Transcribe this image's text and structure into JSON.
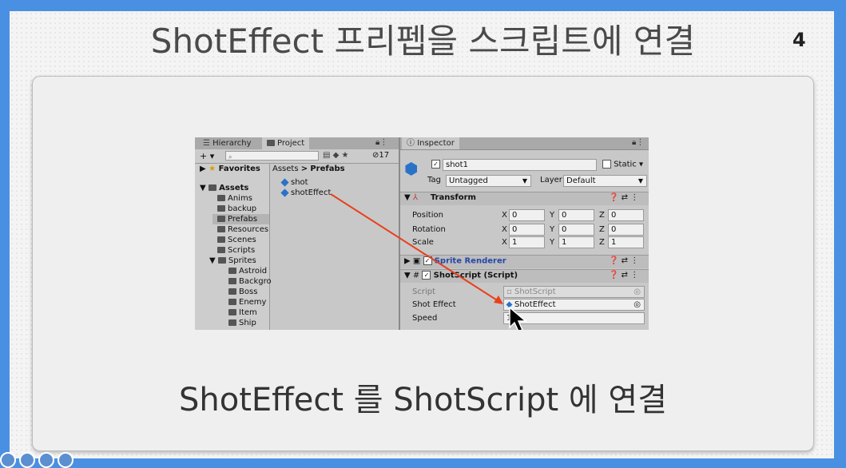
{
  "slide": {
    "title": "ShotEffect 프리펩을 스크립트에 연결",
    "page_number": "4",
    "caption": "ShotEffect 를 ShotScript 에 연결"
  },
  "unity": {
    "tabs": {
      "hierarchy": "Hierarchy",
      "project": "Project",
      "inspector": "Inspector"
    },
    "project": {
      "add_button": "+ ▾",
      "hidden_count": "17",
      "favorites": "Favorites",
      "assets": "Assets",
      "folders": [
        "Anims",
        "backup",
        "Prefabs",
        "Resources",
        "Scenes",
        "Scripts"
      ],
      "sprites_folder": "Sprites",
      "sprite_subfolders": [
        "Astroid",
        "Backgro",
        "Boss",
        "Enemy",
        "Item",
        "Ship"
      ],
      "breadcrumb_root": "Assets",
      "breadcrumb_sep": ">",
      "breadcrumb_current": "Prefabs",
      "prefabs": [
        "shot",
        "shotEffect"
      ]
    },
    "inspector": {
      "object_name": "shot1",
      "static_label": "Static ▾",
      "tag_label": "Tag",
      "tag_value": "Untagged",
      "layer_label": "Layer",
      "layer_value": "Default",
      "transform_title": "Transform",
      "position_label": "Position",
      "rotation_label": "Rotation",
      "scale_label": "Scale",
      "position": {
        "x": "0",
        "y": "0",
        "z": "0"
      },
      "rotation": {
        "x": "0",
        "y": "0",
        "z": "0"
      },
      "scale": {
        "x": "1",
        "y": "1",
        "z": "1"
      },
      "axis": {
        "x": "X",
        "y": "Y",
        "z": "Z"
      },
      "sprite_renderer_title": "Sprite Renderer",
      "shot_script_title": "ShotScript (Script)",
      "script_label": "Script",
      "script_value": "ShotScript",
      "shot_effect_label": "Shot Effect",
      "shot_effect_value": "ShotEffect",
      "speed_label": "Speed",
      "speed_value": "1"
    }
  },
  "colors": {
    "arrow": "#e8401c",
    "slide_border": "#4a90e2"
  }
}
